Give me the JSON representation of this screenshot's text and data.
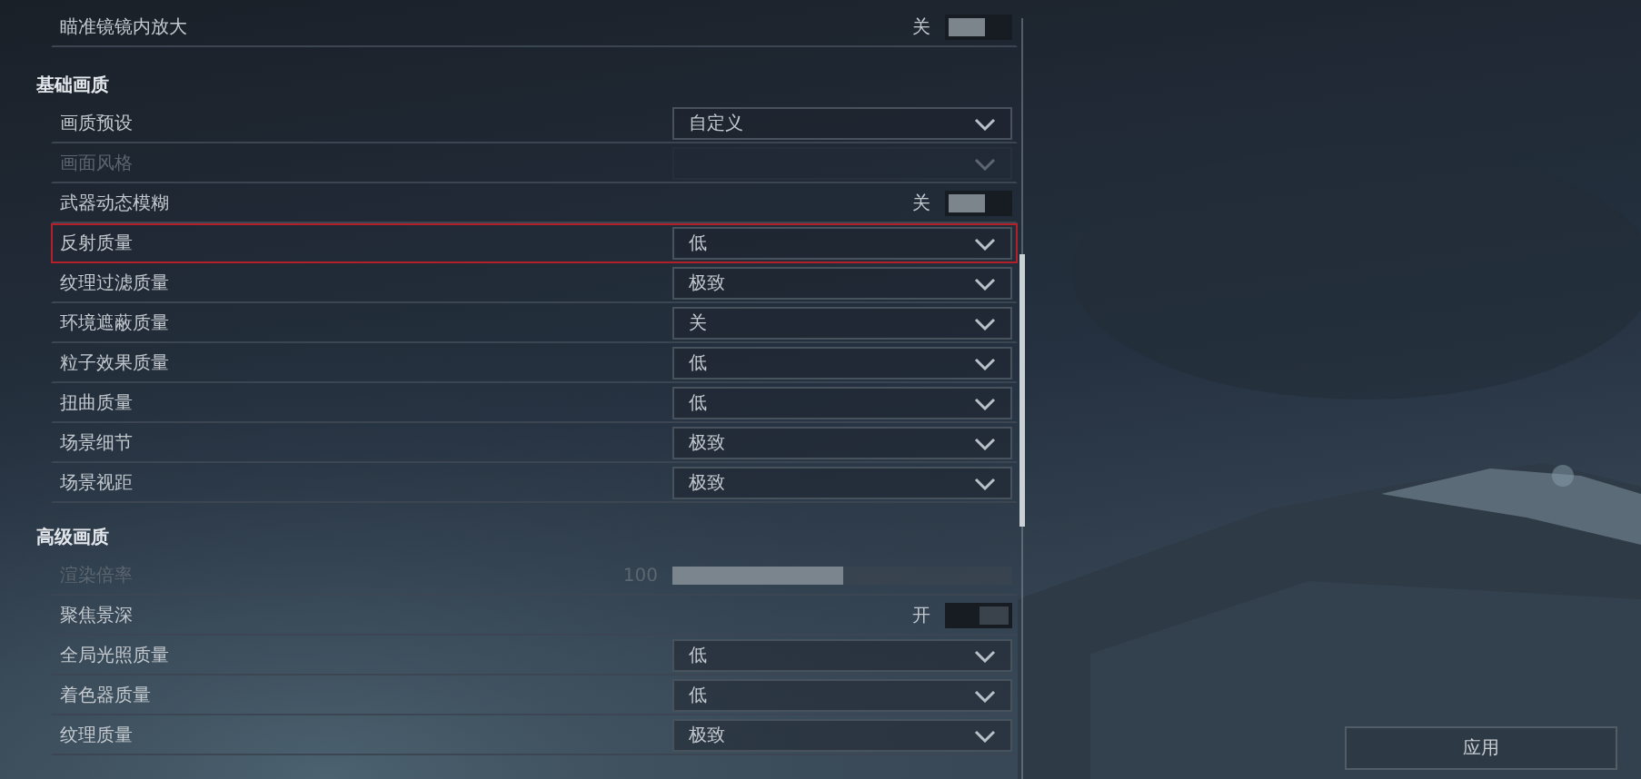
{
  "sections": [
    {
      "rows": [
        {
          "kind": "toggle",
          "label": "瞄准镜镜内放大",
          "value": "关",
          "on": false,
          "disabled": false,
          "selected": false
        }
      ]
    },
    {
      "title": "基础画质",
      "rows": [
        {
          "kind": "dropdown",
          "label": "画质预设",
          "value": "自定义",
          "disabled": false,
          "selected": false
        },
        {
          "kind": "dropdown",
          "label": "画面风格",
          "disabled": true,
          "selected": false
        },
        {
          "kind": "toggle",
          "label": "武器动态模糊",
          "value": "关",
          "on": false,
          "disabled": false,
          "selected": false
        },
        {
          "kind": "dropdown",
          "label": "反射质量",
          "value": "低",
          "disabled": false,
          "selected": true
        },
        {
          "kind": "dropdown",
          "label": "纹理过滤质量",
          "value": "极致",
          "disabled": false,
          "selected": false
        },
        {
          "kind": "dropdown",
          "label": "环境遮蔽质量",
          "value": "关",
          "disabled": false,
          "selected": false
        },
        {
          "kind": "dropdown",
          "label": "粒子效果质量",
          "value": "低",
          "disabled": false,
          "selected": false
        },
        {
          "kind": "dropdown",
          "label": "扭曲质量",
          "value": "低",
          "disabled": false,
          "selected": false
        },
        {
          "kind": "dropdown",
          "label": "场景细节",
          "value": "极致",
          "disabled": false,
          "selected": false
        },
        {
          "kind": "dropdown",
          "label": "场景视距",
          "value": "极致",
          "disabled": false,
          "selected": false
        }
      ]
    },
    {
      "title": "高级画质",
      "rows": [
        {
          "kind": "slider",
          "label": "渲染倍率",
          "value": "100",
          "level": 0.5,
          "disabled": true,
          "selected": false
        },
        {
          "kind": "toggle",
          "label": "聚焦景深",
          "value": "开",
          "on": true,
          "disabled": false,
          "selected": false
        },
        {
          "kind": "dropdown",
          "label": "全局光照质量",
          "value": "低",
          "disabled": false,
          "selected": false
        },
        {
          "kind": "dropdown",
          "label": "着色器质量",
          "value": "低",
          "disabled": false,
          "selected": false
        },
        {
          "kind": "dropdown",
          "label": "纹理质量",
          "value": "极致",
          "disabled": false,
          "selected": false
        }
      ]
    }
  ],
  "apply_button": "应用"
}
